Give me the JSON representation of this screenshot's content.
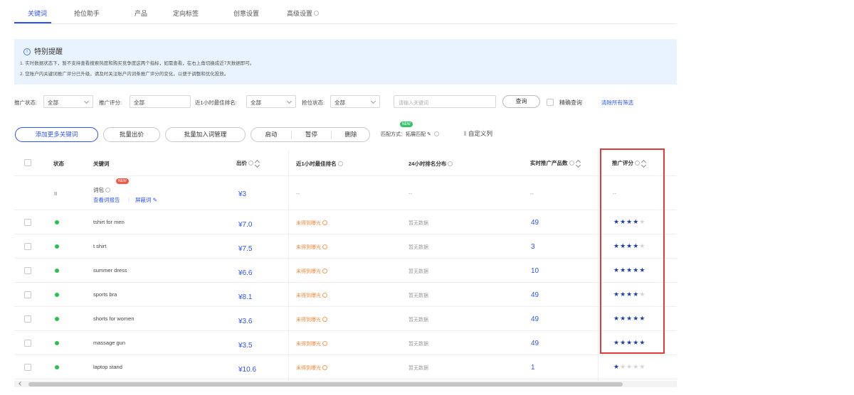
{
  "tabs": [
    {
      "label": "关键词",
      "active": true
    },
    {
      "label": "抢位助手"
    },
    {
      "label": "产品"
    },
    {
      "label": "定向标签"
    },
    {
      "label": "创意设置"
    },
    {
      "label": "高级设置"
    }
  ],
  "notice": {
    "title": "特别提醒",
    "lines": [
      "1. 实时数据状态下，暂不支持查看搜索热度和购买竞争度这两个指标，如需查看，在右上角切换成近7天数据即可。",
      "2. 您账户内关键词推广评分已升级，请及时关注账户内词条推广评分的变化，以便于调整和优化投放。"
    ]
  },
  "filters": {
    "status_label": "推广状态:",
    "status_value": "全部",
    "score_label": "推广评分:",
    "score_value": "全部",
    "rank_label": "近1小时最佳排名:",
    "rank_value": "全部",
    "bid_label": "抢位状态:",
    "bid_value": "全部",
    "search_placeholder": "请输入关键词",
    "query_label": "查询",
    "exact_label": "精确查询",
    "clear_label": "清除所有筛选"
  },
  "actions": {
    "add_more": "添加更多关键词",
    "batch_bid": "批量出价",
    "batch_add_manage": "批量加入词管理",
    "start": "启动",
    "pause": "暂停",
    "delete": "删除",
    "match_label": "匹配方式：",
    "match_value": "拓展匹配",
    "new_badge": "NEW",
    "custom_columns": "自定义列"
  },
  "table": {
    "headers": {
      "status": "状态",
      "keyword": "关键词",
      "bid": "出价",
      "best_rank": "近1小时最佳排名",
      "rank_dist": "24小时排名分布",
      "product_count": "实时推广产品数",
      "score": "推广评分"
    },
    "package_row": {
      "status": "II",
      "name": "词包",
      "badge": "NEW",
      "report_link": "查看词报告",
      "manage_link": "屏蔽词",
      "bid": "¥3",
      "best_rank": "--",
      "rank_dist": "--",
      "product_count": "--",
      "score": "--"
    },
    "rows": [
      {
        "keyword": "tshirt for men",
        "bid": "¥7.0",
        "best_rank": "未得到曝光",
        "rank_dist": "暂无数据",
        "product_count": "49",
        "stars": 4
      },
      {
        "keyword": "t shirt",
        "bid": "¥7.5",
        "best_rank": "未得到曝光",
        "rank_dist": "暂无数据",
        "product_count": "3",
        "stars": 4
      },
      {
        "keyword": "summer dress",
        "bid": "¥6.6",
        "best_rank": "未得到曝光",
        "rank_dist": "暂无数据",
        "product_count": "10",
        "stars": 5
      },
      {
        "keyword": "sports bra",
        "bid": "¥8.1",
        "best_rank": "未得到曝光",
        "rank_dist": "暂无数据",
        "product_count": "49",
        "stars": 4
      },
      {
        "keyword": "shorts for women",
        "bid": "¥3.6",
        "best_rank": "未得到曝光",
        "rank_dist": "暂无数据",
        "product_count": "49",
        "stars": 5
      },
      {
        "keyword": "massage gun",
        "bid": "¥3.5",
        "best_rank": "未得到曝光",
        "rank_dist": "暂无数据",
        "product_count": "49",
        "stars": 5
      },
      {
        "keyword": "laptop stand",
        "bid": "¥10.6",
        "best_rank": "未得到曝光",
        "rank_dist": "暂无数据",
        "product_count": "1",
        "stars": 1
      }
    ]
  },
  "colors": {
    "accent": "#2f54eb",
    "highlight_box": "#e03a3a",
    "status_green": "#29c24f",
    "warning": "#f08a3e"
  }
}
